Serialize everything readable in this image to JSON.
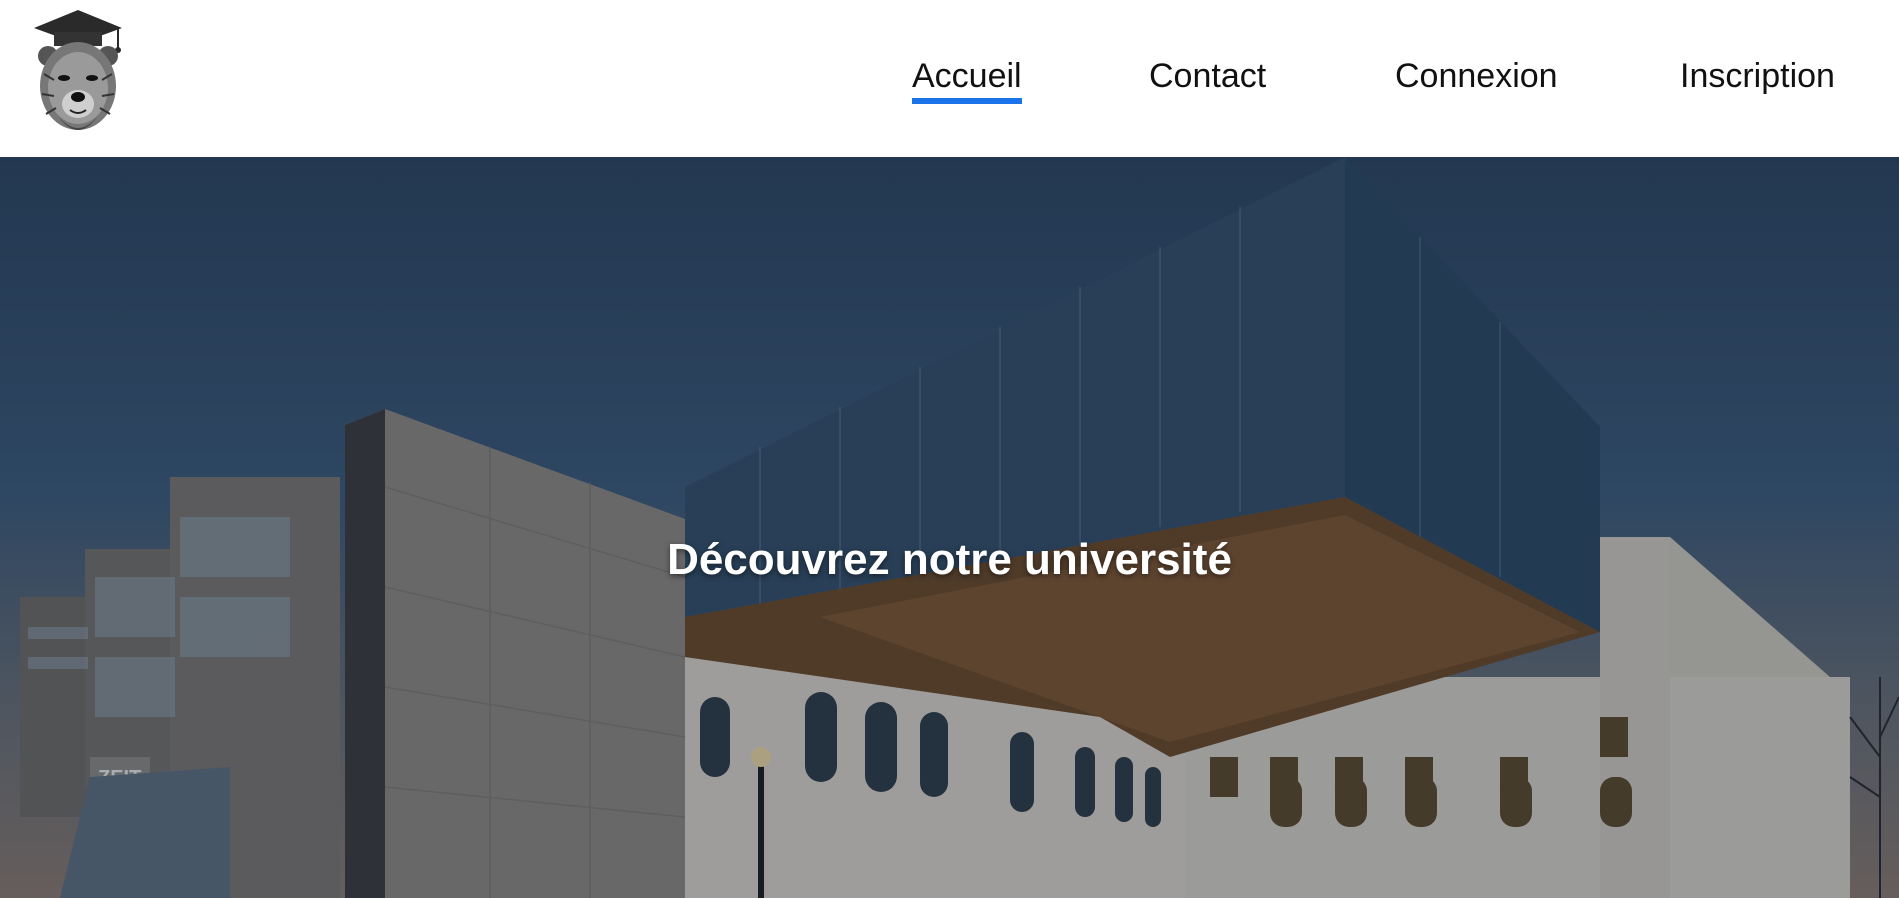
{
  "header": {
    "logo_alt": "bear with graduation cap",
    "nav": [
      {
        "label": "Accueil",
        "active": true
      },
      {
        "label": "Contact",
        "active": false
      },
      {
        "label": "Connexion",
        "active": false
      },
      {
        "label": "Inscription",
        "active": false
      }
    ],
    "active_underline_color": "#1a73e8"
  },
  "hero": {
    "title": "Découvrez notre université",
    "sign_text": "ZEIT"
  }
}
